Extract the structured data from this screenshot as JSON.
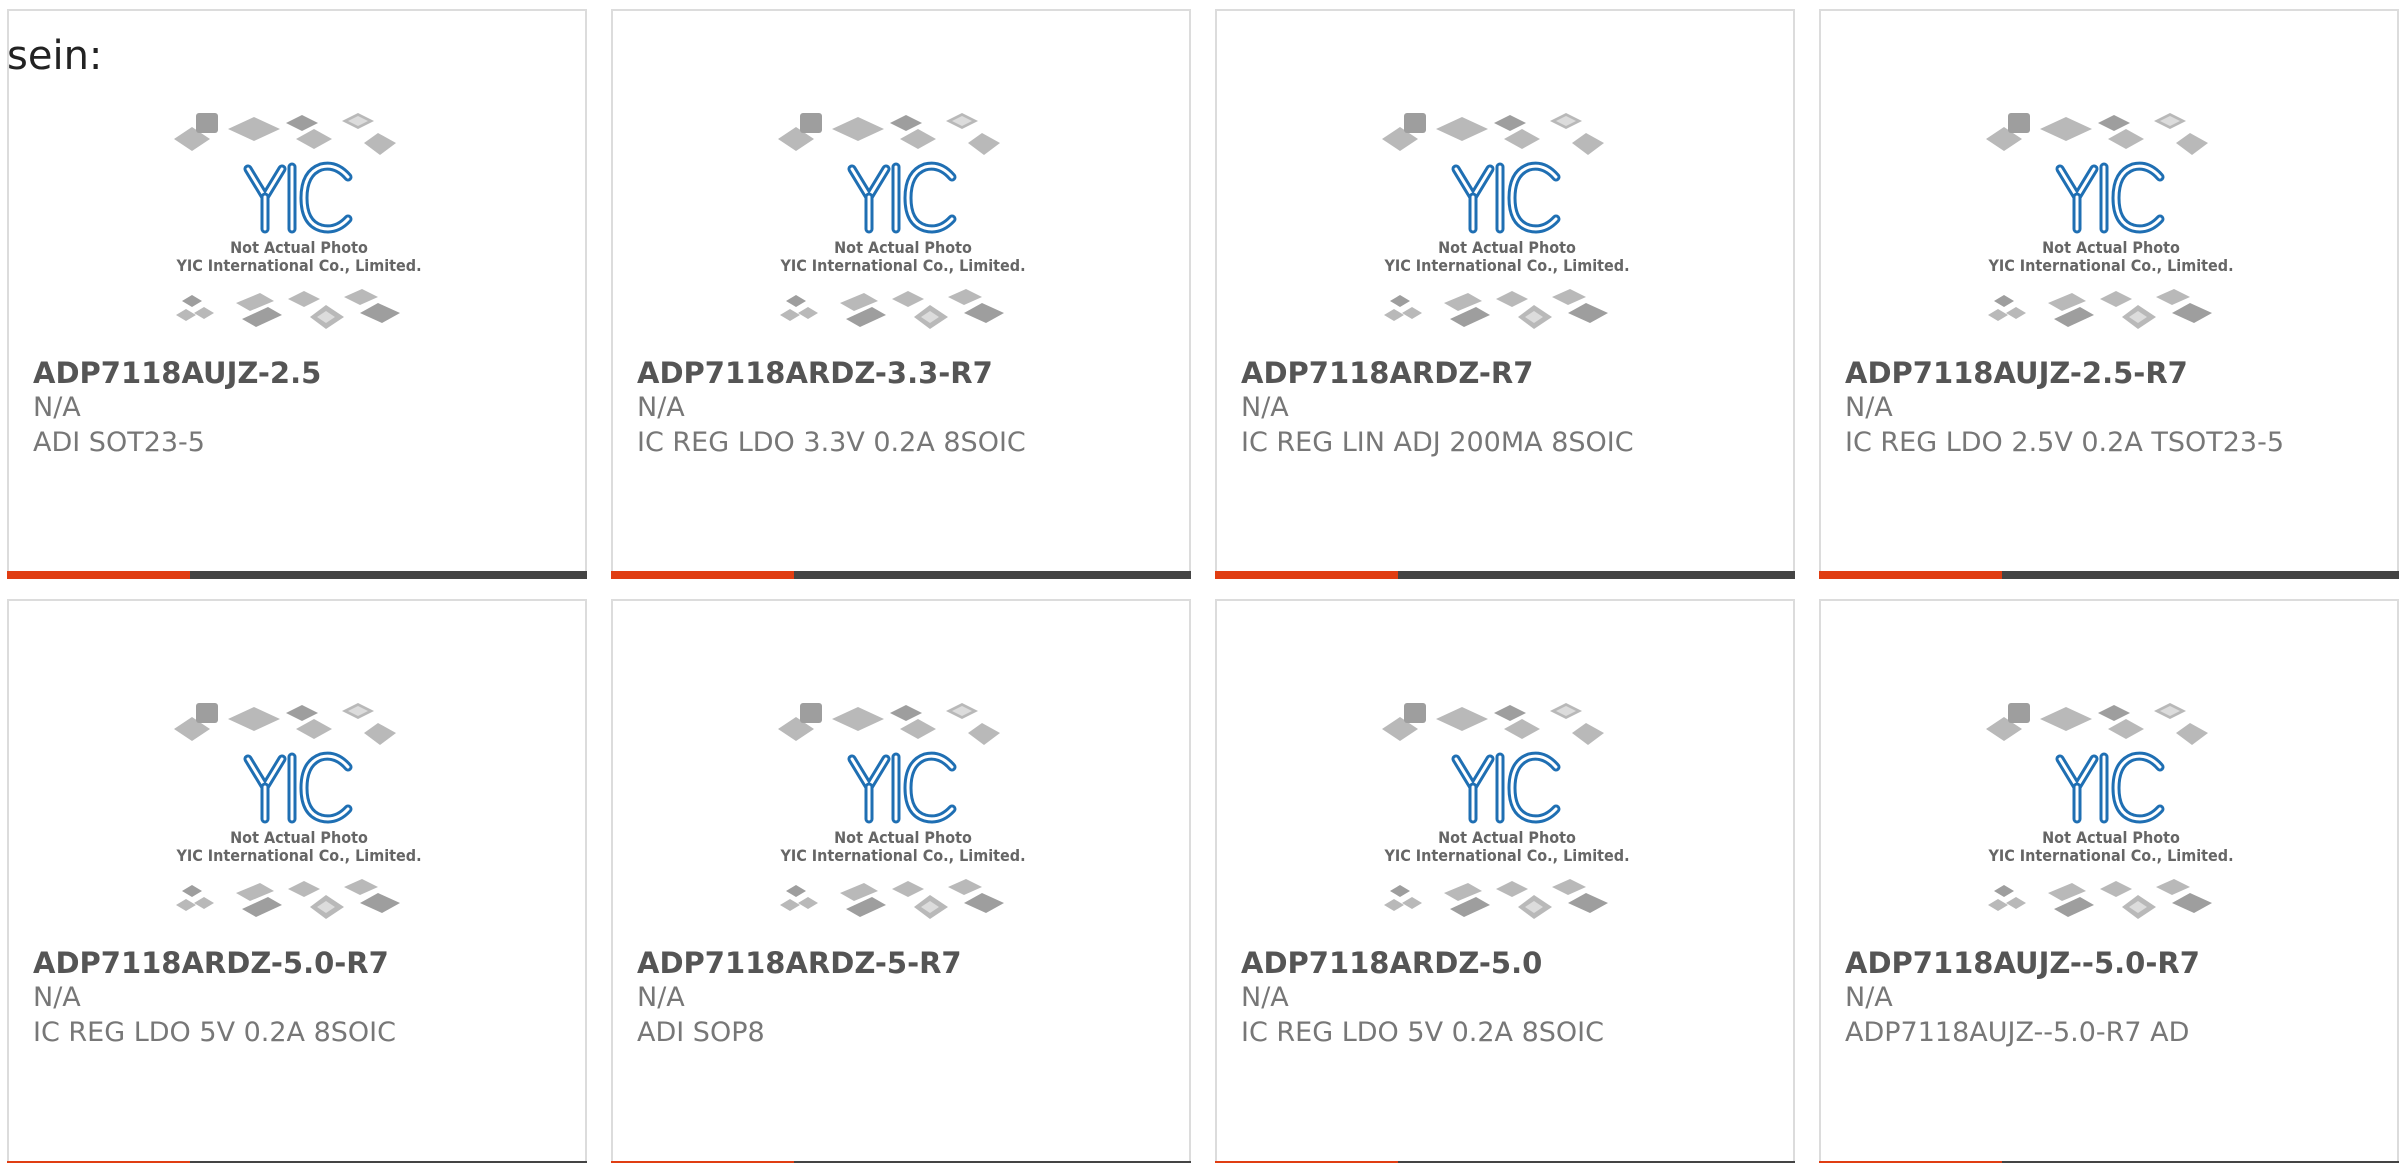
{
  "intro_text": "sein:",
  "placeholder": {
    "line1": "Not Actual Photo",
    "line2": "YIC International Co., Limited."
  },
  "colors": {
    "accent": "#e03d12",
    "bar": "#444444",
    "logo": "#1f6fb3"
  },
  "products": [
    {
      "part_number": "ADP7118AUJZ-2.5",
      "brand": "N/A",
      "description": "ADI SOT23-5"
    },
    {
      "part_number": "ADP7118ARDZ-3.3-R7",
      "brand": "N/A",
      "description": "IC REG LDO 3.3V 0.2A 8SOIC"
    },
    {
      "part_number": "ADP7118ARDZ-R7",
      "brand": "N/A",
      "description": "IC REG LIN ADJ 200MA 8SOIC"
    },
    {
      "part_number": "ADP7118AUJZ-2.5-R7",
      "brand": "N/A",
      "description": "IC REG LDO 2.5V 0.2A TSOT23-5"
    },
    {
      "part_number": "ADP7118ARDZ-5.0-R7",
      "brand": "N/A",
      "description": "IC REG LDO 5V 0.2A 8SOIC"
    },
    {
      "part_number": "ADP7118ARDZ-5-R7",
      "brand": "N/A",
      "description": "ADI SOP8"
    },
    {
      "part_number": "ADP7118ARDZ-5.0",
      "brand": "N/A",
      "description": "IC REG LDO 5V 0.2A 8SOIC"
    },
    {
      "part_number": "ADP7118AUJZ--5.0-R7",
      "brand": "N/A",
      "description": "ADP7118AUJZ--5.0-R7 AD"
    }
  ]
}
